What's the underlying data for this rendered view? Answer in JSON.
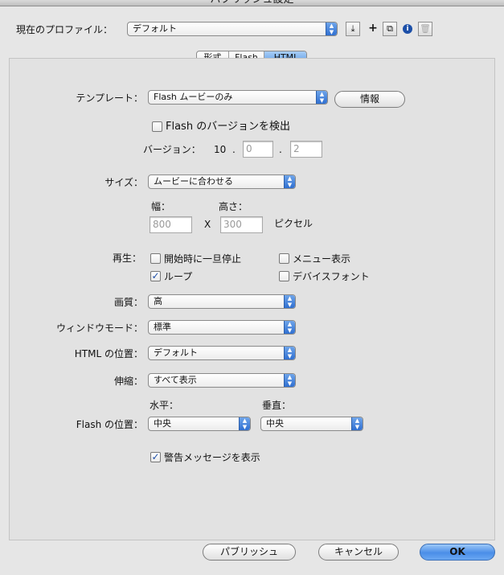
{
  "window": {
    "title": "パブリッシュ設定"
  },
  "profile": {
    "label": "現在のプロファイル：",
    "value": "デフォルト",
    "icons": [
      "import-export-icon",
      "plus-icon",
      "duplicate-icon",
      "info-icon",
      "trash-icon"
    ]
  },
  "tabs": [
    {
      "label": "形式"
    },
    {
      "label": "Flash"
    },
    {
      "label": "HTML"
    }
  ],
  "template": {
    "label": "テンプレート：",
    "value": "Flash ムービーのみ",
    "info_button": "情報"
  },
  "detect": {
    "label": "Flash のバージョンを検出",
    "checked": false
  },
  "version": {
    "label": "バージョン：",
    "major": "10",
    "minor": "0",
    "revision": "2",
    "sep": "."
  },
  "size": {
    "label": "サイズ：",
    "value": "ムービーに合わせる",
    "width_label": "幅：",
    "height_label": "高さ：",
    "width": "800",
    "height": "300",
    "x": "X",
    "unit": "ピクセル"
  },
  "playback": {
    "label": "再生：",
    "pause_label": "開始時に一旦停止",
    "pause_checked": false,
    "loop_label": "ループ",
    "loop_checked": true,
    "menu_label": "メニュー表示",
    "menu_checked": false,
    "device_font_label": "デバイスフォント",
    "device_font_checked": false
  },
  "quality": {
    "label": "画質：",
    "value": "高"
  },
  "window_mode": {
    "label": "ウィンドウモード：",
    "value": "標準"
  },
  "html_align": {
    "label": "HTML の位置：",
    "value": "デフォルト"
  },
  "scale": {
    "label": "伸縮：",
    "value": "すべて表示"
  },
  "flash_align": {
    "label": "Flash の位置：",
    "horizontal_label": "水平：",
    "horizontal": "中央",
    "vertical_label": "垂直：",
    "vertical": "中央"
  },
  "warnings": {
    "label": "警告メッセージを表示",
    "checked": true
  },
  "footer": {
    "publish": "パブリッシュ",
    "cancel": "キャンセル",
    "ok": "OK"
  },
  "colors": {
    "accent": "#4a8ee8",
    "panel": "#e2e2e2",
    "window": "#e6e6e6"
  }
}
